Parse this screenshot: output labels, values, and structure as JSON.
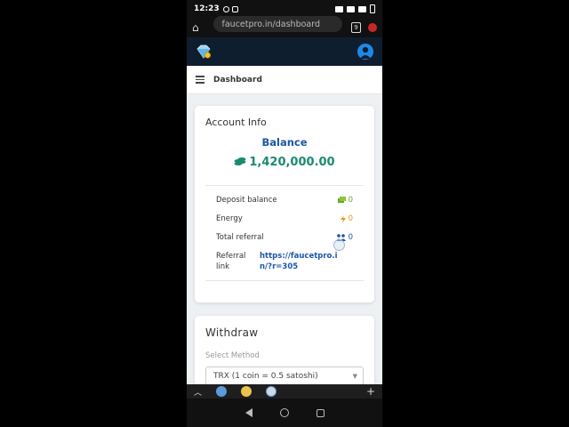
{
  "status": {
    "time": "12:23"
  },
  "browser": {
    "url": "faucetpro.in/dashboard",
    "tab_count": "9"
  },
  "nav": {
    "title": "Dashboard"
  },
  "account": {
    "title": "Account Info",
    "balance_label": "Balance",
    "balance_value": "1,420,000.00",
    "rows": [
      {
        "label": "Deposit balance",
        "value": "0",
        "icon": "money-icon",
        "color": "#6aa524"
      },
      {
        "label": "Energy",
        "value": "0",
        "icon": "bolt-icon",
        "color": "#e09a1a"
      },
      {
        "label": "Total referral",
        "value": "0",
        "icon": "users-icon",
        "color": "#1a56a6"
      }
    ],
    "referral_label": "Referral link",
    "referral_link": "https://faucetpro.in/?r=305"
  },
  "withdraw": {
    "title": "Withdraw",
    "method_label": "Select Method",
    "method_value": "TRX (1 coin = 0.5 satoshi)"
  },
  "colors": {
    "accent": "#1a56a6",
    "balance": "#1a8a70",
    "header_bg": "#0f1e2e"
  }
}
